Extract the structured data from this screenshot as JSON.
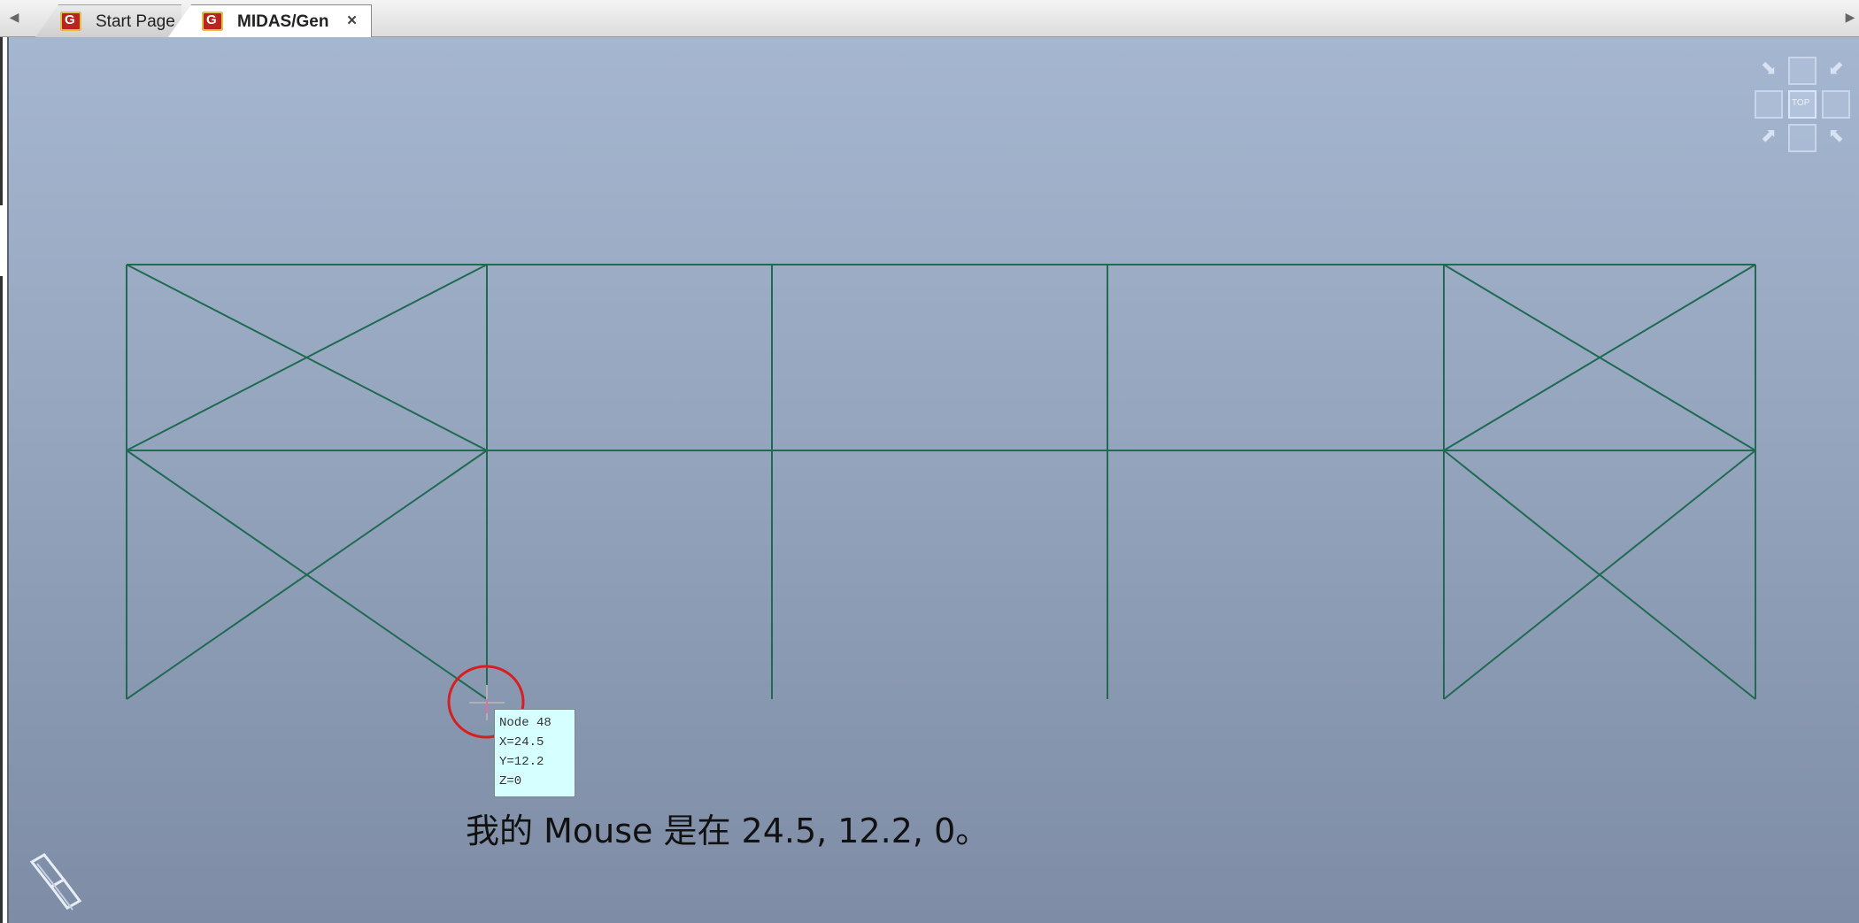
{
  "tabs": [
    {
      "label": "Start Page",
      "active": false
    },
    {
      "label": "MIDAS/Gen",
      "active": true,
      "close": "×"
    }
  ],
  "scroll_left": "◀",
  "scroll_right": "▶",
  "view_cube": {
    "face": "TOP"
  },
  "tooltip": {
    "node": "Node 48",
    "x": "X=24.5",
    "y": "Y=12.2",
    "z": "Z=0"
  },
  "caption": "我的 Mouse 是在 24.5, 12.2, 0。",
  "colors": {
    "frame": "#1f6b52",
    "viewport_top": "#a5b6d0",
    "viewport_bottom": "#7e8ca6",
    "highlight_circle": "#d62020",
    "tooltip_bg": "#d6ffff"
  }
}
